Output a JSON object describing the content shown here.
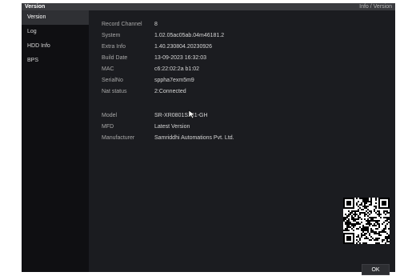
{
  "window": {
    "title": "Version",
    "breadcrumb": "Info / Version"
  },
  "sidebar": {
    "items": [
      {
        "label": "Version",
        "active": true
      },
      {
        "label": "Log",
        "active": false
      },
      {
        "label": "HDD Info",
        "active": false
      },
      {
        "label": "BPS",
        "active": false
      }
    ]
  },
  "info": {
    "record_channel": {
      "label": "Record Channel",
      "value": "8"
    },
    "system": {
      "label": "System",
      "value": "1.02.05ac05ab.04m46181.2"
    },
    "extra_info": {
      "label": "Extra Info",
      "value": "1.40.230804.20230926"
    },
    "build_date": {
      "label": "Build Date",
      "value": "13-09-2023 16:32:03"
    },
    "mac": {
      "label": "MAC",
      "value": "c6:22:02:2a b1:02"
    },
    "serial_no": {
      "label": "SerialNo",
      "value": "sppha7exm5m9"
    },
    "nat_status": {
      "label": "Nat status",
      "value": "2:Connected"
    },
    "model": {
      "label": "Model",
      "value": "SR-XR0801S201-GH"
    },
    "mfd": {
      "label": "MFD",
      "value": "Latest Version"
    },
    "manufacturer": {
      "label": "Manufacturer",
      "value": "Samriddhi Automations Pvt. Ltd."
    }
  },
  "qr": {
    "icon": "qr-code-icon"
  },
  "footer": {
    "ok_label": "OK"
  },
  "colors": {
    "background": "#1b1c20",
    "sidebar": "#0f0f12",
    "titlebar": "#3a3b3f",
    "active_item": "#2f3034"
  }
}
